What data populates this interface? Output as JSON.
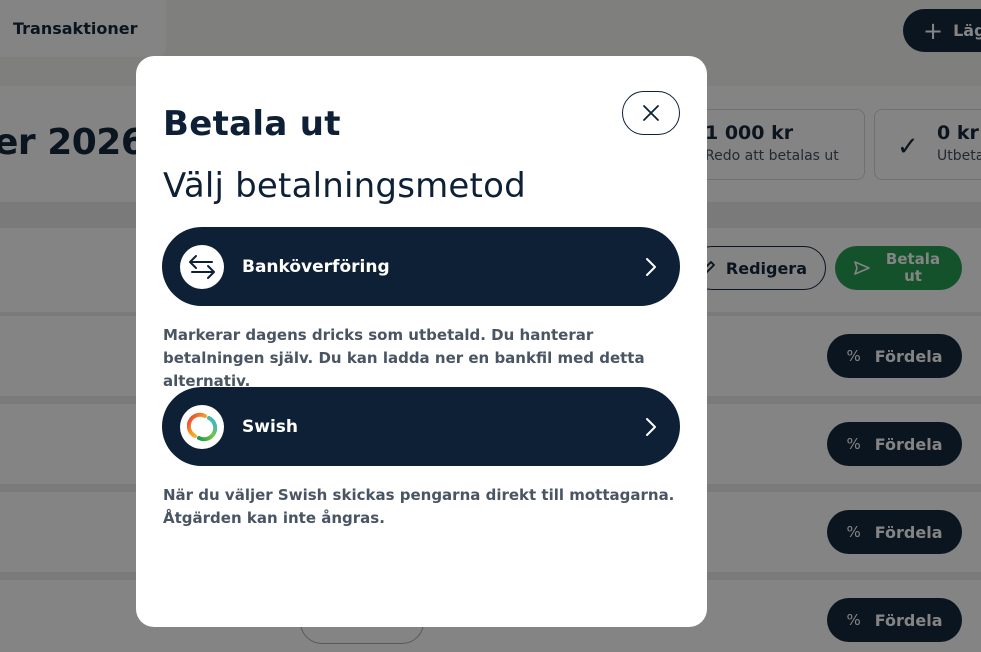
{
  "background": {
    "tab_label": "Transaktioner",
    "add_button_label": "Läg",
    "period_title": "er 2026",
    "stat_ready": {
      "amount": "1 000 kr",
      "label": "Redo att betalas ut"
    },
    "stat_paid": {
      "amount": "0 kr",
      "label": "Utbeta"
    },
    "edit_button_label": "Redigera",
    "payout_button_label": "Betala ut",
    "distribute_buttons": [
      {
        "label": "Fördela"
      },
      {
        "label": "Fördela"
      },
      {
        "label": "Fördela"
      },
      {
        "label": "Fördela"
      }
    ],
    "percent_symbol": "%"
  },
  "modal": {
    "title": "Betala ut",
    "subtitle": "Välj betalningsmetod",
    "methods": [
      {
        "label": "Banköverföring",
        "icon": "transfer-arrows-icon",
        "description": "Markerar dagens dricks som utbetald. Du hanterar betalningen själv. Du kan ladda ner en bankfil med detta alternativ."
      },
      {
        "label": "Swish",
        "icon": "swish-logo-icon",
        "description": "När du väljer Swish skickas pengarna direkt till mottagarna. Åtgärden kan inte ångras."
      }
    ]
  },
  "colors": {
    "primary": "#0d2035",
    "success": "#1f9a4f",
    "overlay": "rgba(10,10,10,0.5)"
  }
}
